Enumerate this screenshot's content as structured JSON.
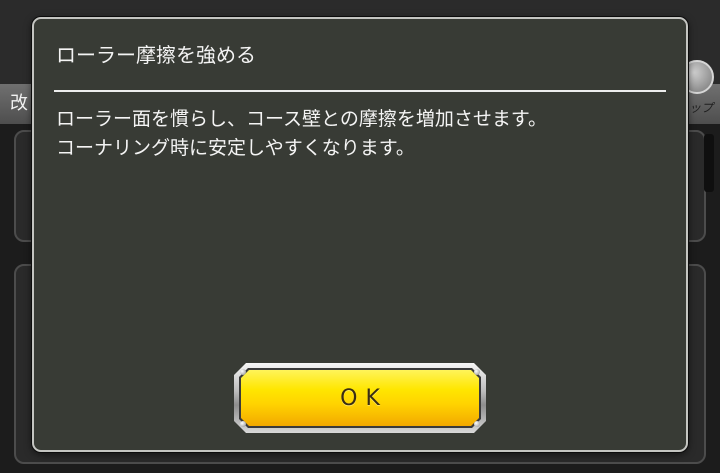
{
  "background": {
    "left_tab_label": "改",
    "right_tab_label": "ップ",
    "right_icon": "round-badge-icon"
  },
  "dialog": {
    "title": "ローラー摩擦を強める",
    "body_lines": [
      "ローラー面を慣らし、コース壁との摩擦を増加させます。",
      "コーナリング時に安定しやすくなります。"
    ],
    "ok_button": {
      "label": "OK"
    }
  },
  "colors": {
    "dialog_bg": "#383b35",
    "dialog_border": "#c4c5c1",
    "text": "#f4f4f4",
    "button_yellow_top": "#fff45a",
    "button_yellow_bottom": "#f2a800",
    "button_text": "#3a2e14"
  }
}
